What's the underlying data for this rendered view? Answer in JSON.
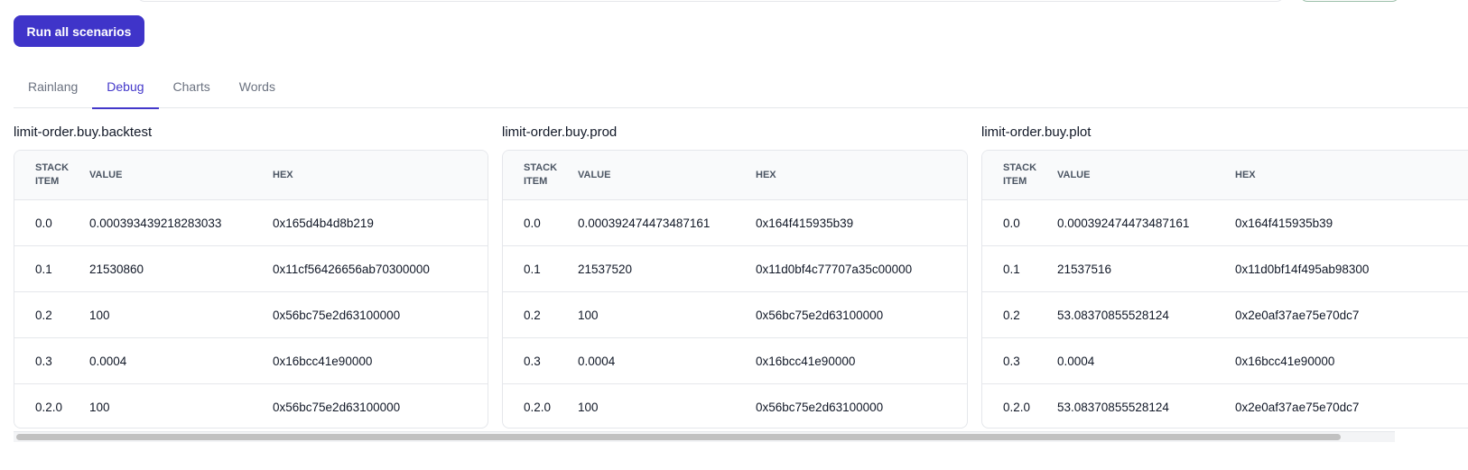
{
  "toolbar": {
    "run_label": "Run all scenarios"
  },
  "tabs": [
    {
      "label": "Rainlang",
      "active": false
    },
    {
      "label": "Debug",
      "active": true
    },
    {
      "label": "Charts",
      "active": false
    },
    {
      "label": "Words",
      "active": false
    }
  ],
  "columns": {
    "stack": "STACK ITEM",
    "value": "VALUE",
    "hex": "HEX"
  },
  "panels": [
    {
      "title": "limit-order.buy.backtest",
      "rows": [
        {
          "stack": "0.0",
          "value": "0.000393439218283033",
          "hex": "0x165d4b4d8b219"
        },
        {
          "stack": "0.1",
          "value": "21530860",
          "hex": "0x11cf56426656ab70300000"
        },
        {
          "stack": "0.2",
          "value": "100",
          "hex": "0x56bc75e2d63100000"
        },
        {
          "stack": "0.3",
          "value": "0.0004",
          "hex": "0x16bcc41e90000"
        },
        {
          "stack": "0.2.0",
          "value": "100",
          "hex": "0x56bc75e2d63100000"
        }
      ]
    },
    {
      "title": "limit-order.buy.prod",
      "rows": [
        {
          "stack": "0.0",
          "value": "0.000392474473487161",
          "hex": "0x164f415935b39"
        },
        {
          "stack": "0.1",
          "value": "21537520",
          "hex": "0x11d0bf4c77707a35c00000"
        },
        {
          "stack": "0.2",
          "value": "100",
          "hex": "0x56bc75e2d63100000"
        },
        {
          "stack": "0.3",
          "value": "0.0004",
          "hex": "0x16bcc41e90000"
        },
        {
          "stack": "0.2.0",
          "value": "100",
          "hex": "0x56bc75e2d63100000"
        }
      ]
    },
    {
      "title": "limit-order.buy.plot",
      "rows": [
        {
          "stack": "0.0",
          "value": "0.000392474473487161",
          "hex": "0x164f415935b39"
        },
        {
          "stack": "0.1",
          "value": "21537516",
          "hex": "0x11d0bf14f495ab98300"
        },
        {
          "stack": "0.2",
          "value": "53.08370855528124",
          "hex": "0x2e0af37ae75e70dc7"
        },
        {
          "stack": "0.3",
          "value": "0.0004",
          "hex": "0x16bcc41e90000"
        },
        {
          "stack": "0.2.0",
          "value": "53.08370855528124",
          "hex": "0x2e0af37ae75e70dc7"
        }
      ]
    }
  ],
  "colors": {
    "accent": "#4338ca",
    "button": "#3f34c9"
  }
}
